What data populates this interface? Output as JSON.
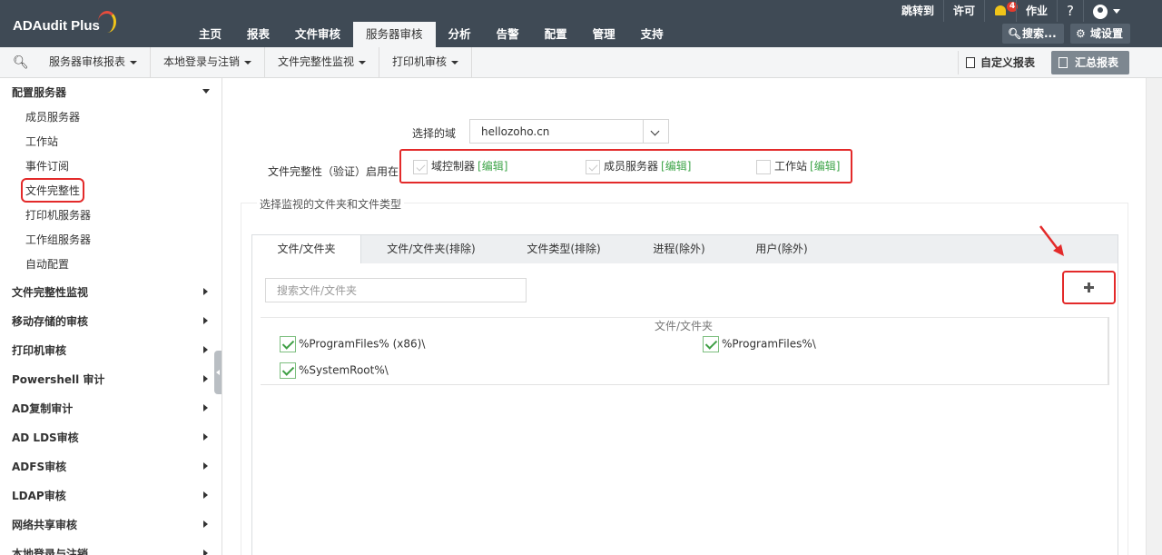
{
  "app": {
    "logo_text": "ADAudit Plus"
  },
  "top_util": {
    "jump": "跳转到",
    "license": "许可",
    "notification_count": "4",
    "jobs": "作业",
    "help": "?"
  },
  "main_tabs": [
    "主页",
    "报表",
    "文件审核",
    "服务器审核",
    "分析",
    "告警",
    "配置",
    "管理",
    "支持"
  ],
  "header_buttons": {
    "search": "搜索...",
    "domain_settings": "域设置"
  },
  "sub_menu": [
    "服务器审核报表",
    "本地登录与注销",
    "文件完整性监视",
    "打印机审核"
  ],
  "sub_buttons": {
    "custom_report": "自定义报表",
    "summary_report": "汇总报表"
  },
  "sidebar": {
    "configure_servers": "配置服务器",
    "sub_items": [
      "成员服务器",
      "工作站",
      "事件订阅",
      "文件完整性",
      "打印机服务器",
      "工作组服务器",
      "自动配置"
    ],
    "sections": [
      "文件完整性监视",
      "移动存储的审核",
      "打印机审核",
      "Powershell 审计",
      "AD复制审计",
      "AD LDS审核",
      "ADFS审核",
      "LDAP审核",
      "网络共享审核",
      "本地登录与注销"
    ]
  },
  "form": {
    "domain_label": "选择的域",
    "domain_value": "hellozoho.cn",
    "enabled_label": "文件完整性（验证）启用在",
    "targets": [
      {
        "label": "域控制器",
        "edit": "[编辑]"
      },
      {
        "label": "成员服务器",
        "edit": "[编辑]"
      },
      {
        "label": "工作站",
        "edit": "[编辑]"
      }
    ],
    "fieldset_legend": "选择监视的文件夹和文件类型"
  },
  "tabs": [
    "文件/文件夹",
    "文件/文件夹(排除)",
    "文件类型(排除)",
    "进程(除外)",
    "用户(除外)"
  ],
  "folder_panel": {
    "search_placeholder": "搜索文件/文件夹",
    "column_header": "文件/文件夹",
    "folders": [
      "%ProgramFiles% (x86)\\",
      "%ProgramFiles%\\",
      "%SystemRoot%\\"
    ]
  },
  "colors": {
    "header": "#3f4a55",
    "highlight": "#e32a2a",
    "edit_link": "#3fa54a"
  }
}
